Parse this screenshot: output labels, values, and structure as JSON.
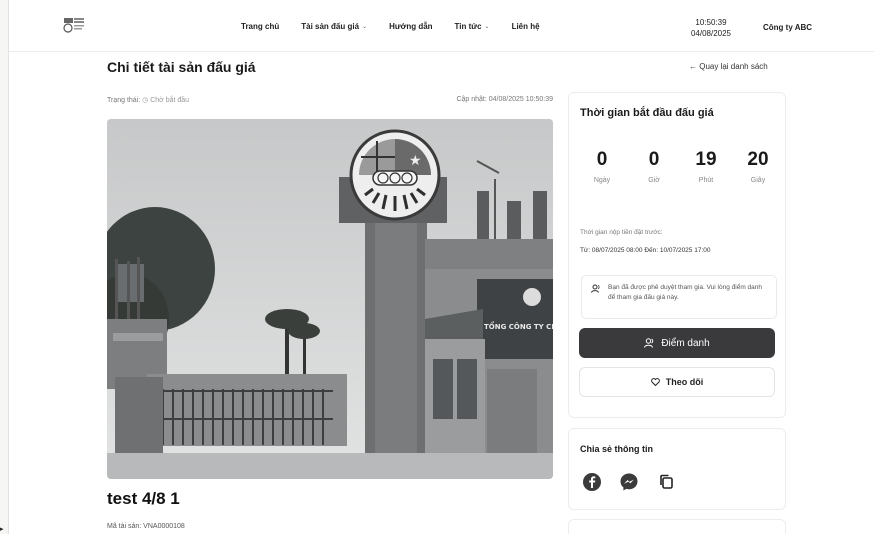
{
  "header": {
    "nav": [
      {
        "label": "Trang chủ",
        "has_dropdown": false
      },
      {
        "label": "Tài sản đấu giá",
        "has_dropdown": true
      },
      {
        "label": "Hướng dẫn",
        "has_dropdown": false
      },
      {
        "label": "Tin tức",
        "has_dropdown": true
      },
      {
        "label": "Liên hệ",
        "has_dropdown": false
      }
    ],
    "time": "10:50:39",
    "date": "04/08/2025",
    "company": "Công ty ABC"
  },
  "page": {
    "title": "Chi tiết tài sản đấu giá",
    "back_link": "← Quay lại danh sách"
  },
  "status": {
    "label": "Trạng thái:",
    "value": "Chờ bắt đầu",
    "updated_label": "Cập nhật:",
    "updated_value": "04/08/2025 10:50:39"
  },
  "asset": {
    "title": "test 4/8 1",
    "code": "Mã tài sản: VNA0000108",
    "sign_text": "TỔNG CÔNG TY CHĂ"
  },
  "countdown": {
    "title": "Thời gian bắt đầu đấu giá",
    "units": [
      {
        "value": "0",
        "label": "Ngày"
      },
      {
        "value": "0",
        "label": "Giờ"
      },
      {
        "value": "19",
        "label": "Phút"
      },
      {
        "value": "20",
        "label": "Giây"
      }
    ],
    "deposit_label": "Thời gian nộp tiền đặt trước:",
    "deposit_time": "Từ: 08/07/2025 08:00 Đến: 10/07/2025 17:00",
    "notice": "Bạn đã được phê duyệt tham gia. Vui lòng điểm danh để tham gia đấu giá này.",
    "checkin_label": "Điểm danh",
    "follow_label": "Theo dõi"
  },
  "share": {
    "title": "Chia sẻ thông tin",
    "icons": [
      "facebook-icon",
      "messenger-icon",
      "copy-icon"
    ]
  },
  "colors": {
    "primary_button": "#3a3a3c",
    "border": "#ececec"
  }
}
